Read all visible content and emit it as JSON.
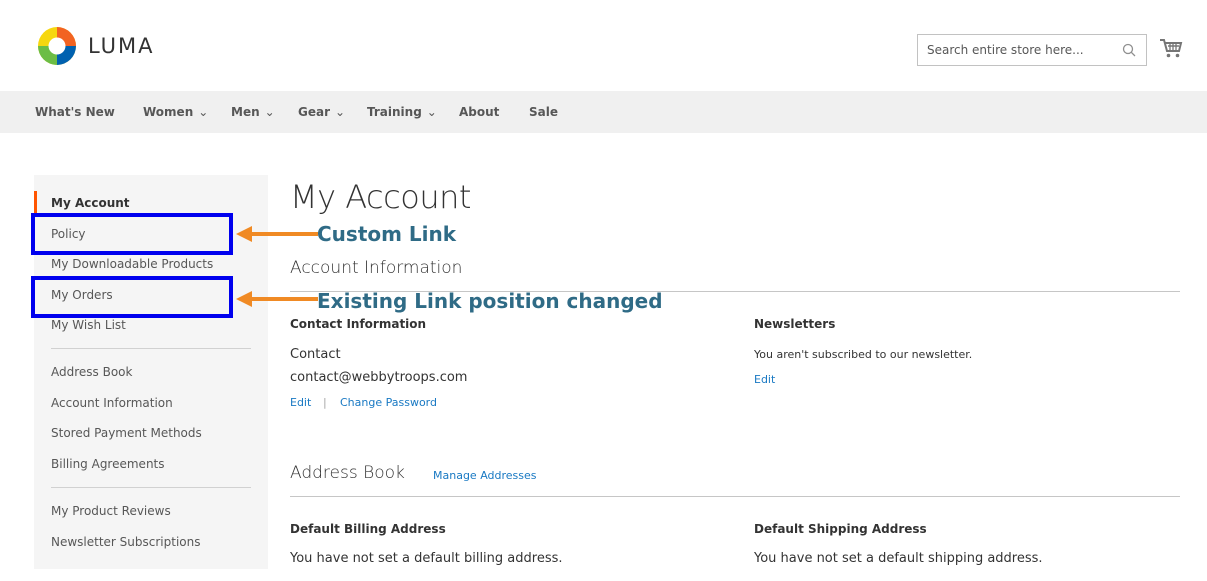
{
  "header": {
    "logo_text": "LUMA",
    "search_placeholder": "Search entire store here...",
    "brand_colors": {
      "orange": "#f26322",
      "yellow": "#f6d70f",
      "green": "#6cbd45",
      "blue": "#0061b0"
    }
  },
  "nav": {
    "items": [
      {
        "label": "What's New",
        "has_submenu": false
      },
      {
        "label": "Women",
        "has_submenu": true
      },
      {
        "label": "Men",
        "has_submenu": true
      },
      {
        "label": "Gear",
        "has_submenu": true
      },
      {
        "label": "Training",
        "has_submenu": true
      },
      {
        "label": "About",
        "has_submenu": false
      },
      {
        "label": "Sale",
        "has_submenu": false
      }
    ]
  },
  "sidebar": {
    "group1": [
      {
        "label": "My Account",
        "current": true
      },
      {
        "label": "Policy"
      },
      {
        "label": "My Downloadable Products"
      },
      {
        "label": "My Orders"
      },
      {
        "label": "My Wish List"
      }
    ],
    "group2": [
      {
        "label": "Address Book"
      },
      {
        "label": "Account Information"
      },
      {
        "label": "Stored Payment Methods"
      },
      {
        "label": "Billing Agreements"
      }
    ],
    "group3": [
      {
        "label": "My Product Reviews"
      },
      {
        "label": "Newsletter Subscriptions"
      }
    ],
    "accent_color": "#ff5501"
  },
  "annotations": {
    "custom_link": "Custom Link",
    "existing_link": "Existing Link position changed",
    "box_color": "#0000ee",
    "arrow_color": "#f08a24"
  },
  "main": {
    "page_title": "My Account",
    "account_info": {
      "title": "Account Information",
      "contact": {
        "title": "Contact Information",
        "name": "Contact",
        "email": "contact@webbytroops.com",
        "edit_label": "Edit",
        "separator": "|",
        "change_password_label": "Change Password"
      },
      "newsletters": {
        "title": "Newsletters",
        "text": "You aren't subscribed to our newsletter.",
        "edit_label": "Edit"
      }
    },
    "address_book": {
      "title": "Address Book",
      "manage_label": "Manage Addresses",
      "billing": {
        "title": "Default Billing Address",
        "text": "You have not set a default billing address."
      },
      "shipping": {
        "title": "Default Shipping Address",
        "text": "You have not set a default shipping address."
      }
    }
  }
}
